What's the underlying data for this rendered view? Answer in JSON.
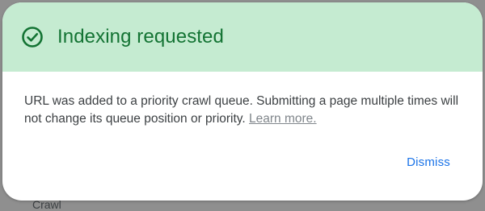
{
  "backdrop": {
    "partial_text": "Crawl"
  },
  "dialog": {
    "title": "Indexing requested",
    "icon": "check-circle-icon",
    "body_text": "URL was added to a priority crawl queue. Submitting a page multiple times will not change its queue position or priority.",
    "learn_more_label": "Learn more.",
    "dismiss_label": "Dismiss"
  },
  "colors": {
    "header_background": "#c5ebd1",
    "title_green": "#137333",
    "accent_blue": "#1a73e8",
    "backdrop_gray": "#8f8f8f"
  }
}
